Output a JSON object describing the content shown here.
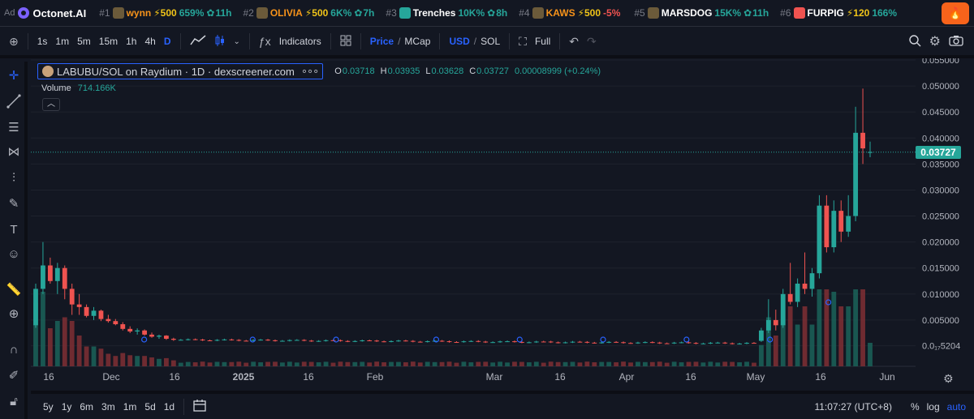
{
  "ticker": {
    "ad_label": "Ad",
    "brand": "Octonet.AI",
    "items": [
      {
        "rank": "#1",
        "name": "wynn",
        "name_color": "#f7931a",
        "boost": "⚡500",
        "change": "659%",
        "change_color": "#26a69a",
        "age": "11h"
      },
      {
        "rank": "#2",
        "name": "OLIVIA",
        "name_color": "#f7931a",
        "boost": "⚡500",
        "change": "6K%",
        "change_color": "#26a69a",
        "age": "7h"
      },
      {
        "rank": "#3",
        "name": "Trenches",
        "name_color": "#ffffff",
        "boost": "",
        "change": "10K%",
        "change_color": "#26a69a",
        "age": "8h"
      },
      {
        "rank": "#4",
        "name": "KAWS",
        "name_color": "#f7931a",
        "boost": "⚡500",
        "change": "-5%",
        "change_color": "#ef5350",
        "age": ""
      },
      {
        "rank": "#5",
        "name": "MARSDOG",
        "name_color": "#ffffff",
        "boost": "",
        "change": "15K%",
        "change_color": "#26a69a",
        "age": "11h"
      },
      {
        "rank": "#6",
        "name": "FURPIG",
        "name_color": "#ffffff",
        "boost": "⚡120",
        "change": "166%",
        "change_color": "#26a69a",
        "age": ""
      }
    ]
  },
  "toolbar": {
    "intervals": [
      "1s",
      "1m",
      "5m",
      "15m",
      "1h",
      "4h",
      "D"
    ],
    "active_interval": "D",
    "indicators_label": "Indicators",
    "price_label": "Price",
    "mcap_label": "MCap",
    "usd_label": "USD",
    "sol_label": "SOL",
    "full_label": "Full"
  },
  "legend": {
    "symbol": "LABUBU/SOL on Raydium · 1D · dexscreener.com",
    "ohlc": [
      {
        "k": "O",
        "v": "0.03718"
      },
      {
        "k": "H",
        "v": "0.03935"
      },
      {
        "k": "L",
        "v": "0.03628"
      },
      {
        "k": "C",
        "v": "0.03727"
      }
    ],
    "change": "0.00008999 (+0.24%)",
    "volume_label": "Volume",
    "volume_value": "714.166K"
  },
  "price_tag": "0.03727",
  "bottombar": {
    "ranges": [
      "5y",
      "1y",
      "6m",
      "3m",
      "1m",
      "5d",
      "1d"
    ],
    "time": "11:07:27 (UTC+8)",
    "pct": "%",
    "log": "log",
    "auto": "auto"
  },
  "colors": {
    "up": "#26a69a",
    "down": "#ef5350",
    "accent": "#2962ff",
    "bg": "#131722"
  },
  "chart_data": {
    "type": "candlestick",
    "y_ticks": [
      "0.055000",
      "0.050000",
      "0.045000",
      "0.040000",
      "0.035000",
      "0.030000",
      "0.025000",
      "0.020000",
      "0.015000",
      "0.010000",
      "0.005000",
      "0.0₁₇5204"
    ],
    "x_ticks": [
      "16",
      "Dec",
      "16",
      "2025",
      "16",
      "Feb",
      "Mar",
      "16",
      "Apr",
      "16",
      "May",
      "16",
      "Jun"
    ],
    "last_price": 0.03727,
    "candles": [
      {
        "o": 0.004,
        "h": 0.012,
        "l": 0.0035,
        "c": 0.011
      },
      {
        "o": 0.011,
        "h": 0.02,
        "l": 0.01,
        "c": 0.0155
      },
      {
        "o": 0.0155,
        "h": 0.017,
        "l": 0.012,
        "c": 0.0125
      },
      {
        "o": 0.0125,
        "h": 0.016,
        "l": 0.01,
        "c": 0.015
      },
      {
        "o": 0.015,
        "h": 0.0155,
        "l": 0.009,
        "c": 0.011
      },
      {
        "o": 0.011,
        "h": 0.012,
        "l": 0.006,
        "c": 0.008
      },
      {
        "o": 0.008,
        "h": 0.01,
        "l": 0.006,
        "c": 0.0075
      },
      {
        "o": 0.0075,
        "h": 0.008,
        "l": 0.0055,
        "c": 0.0058
      },
      {
        "o": 0.0058,
        "h": 0.0075,
        "l": 0.005,
        "c": 0.0068
      },
      {
        "o": 0.0068,
        "h": 0.007,
        "l": 0.0048,
        "c": 0.0052
      },
      {
        "o": 0.0052,
        "h": 0.006,
        "l": 0.0045,
        "c": 0.0048
      },
      {
        "o": 0.0048,
        "h": 0.0052,
        "l": 0.004,
        "c": 0.0042
      },
      {
        "o": 0.0042,
        "h": 0.0046,
        "l": 0.003,
        "c": 0.0033
      },
      {
        "o": 0.0033,
        "h": 0.0038,
        "l": 0.0025,
        "c": 0.0028
      },
      {
        "o": 0.0028,
        "h": 0.0034,
        "l": 0.0022,
        "c": 0.003
      },
      {
        "o": 0.003,
        "h": 0.0032,
        "l": 0.002,
        "c": 0.0022
      },
      {
        "o": 0.0022,
        "h": 0.0026,
        "l": 0.0016,
        "c": 0.0018
      },
      {
        "o": 0.0018,
        "h": 0.0022,
        "l": 0.0014,
        "c": 0.002
      },
      {
        "o": 0.002,
        "h": 0.0021,
        "l": 0.0012,
        "c": 0.0014
      },
      {
        "o": 0.0014,
        "h": 0.0016,
        "l": 0.001,
        "c": 0.0012
      }
    ],
    "flat_segment": {
      "from": 0.0012,
      "to": 0.0005,
      "count": 80
    },
    "pump": [
      {
        "o": 0.001,
        "h": 0.0035,
        "l": 0.0008,
        "c": 0.003
      },
      {
        "o": 0.003,
        "h": 0.009,
        "l": 0.0025,
        "c": 0.005
      },
      {
        "o": 0.005,
        "h": 0.007,
        "l": 0.003,
        "c": 0.004
      },
      {
        "o": 0.004,
        "h": 0.011,
        "l": 0.0035,
        "c": 0.01
      },
      {
        "o": 0.01,
        "h": 0.016,
        "l": 0.008,
        "c": 0.0085
      },
      {
        "o": 0.0085,
        "h": 0.013,
        "l": 0.0075,
        "c": 0.012
      },
      {
        "o": 0.012,
        "h": 0.018,
        "l": 0.01,
        "c": 0.011
      },
      {
        "o": 0.011,
        "h": 0.015,
        "l": 0.0095,
        "c": 0.014
      },
      {
        "o": 0.014,
        "h": 0.029,
        "l": 0.013,
        "c": 0.027
      },
      {
        "o": 0.027,
        "h": 0.029,
        "l": 0.018,
        "c": 0.019
      },
      {
        "o": 0.019,
        "h": 0.028,
        "l": 0.018,
        "c": 0.026
      },
      {
        "o": 0.026,
        "h": 0.028,
        "l": 0.02,
        "c": 0.022
      },
      {
        "o": 0.022,
        "h": 0.029,
        "l": 0.021,
        "c": 0.025
      },
      {
        "o": 0.025,
        "h": 0.046,
        "l": 0.024,
        "c": 0.041
      },
      {
        "o": 0.041,
        "h": 0.0495,
        "l": 0.035,
        "c": 0.038
      },
      {
        "o": 0.0372,
        "h": 0.0393,
        "l": 0.0363,
        "c": 0.0373
      }
    ]
  }
}
